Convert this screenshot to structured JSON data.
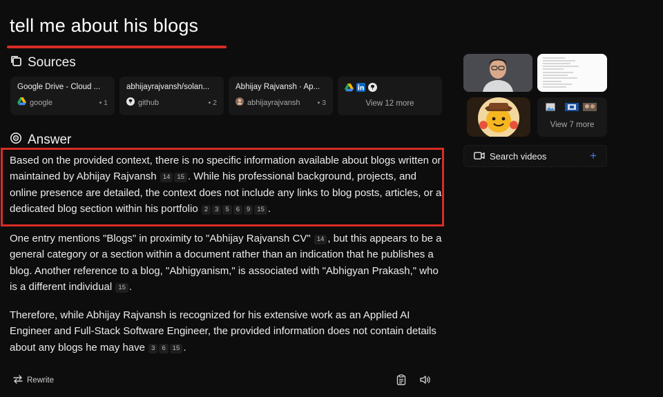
{
  "query": "tell me about his blogs",
  "sources": {
    "heading": "Sources",
    "cards": [
      {
        "title": "Google Drive - Cloud ...",
        "site": "google",
        "num": "1"
      },
      {
        "title": "abhijayrajvansh/solan...",
        "site": "github",
        "num": "2"
      },
      {
        "title": "Abhijay Rajvansh · Ap...",
        "site": "abhijayrajvansh",
        "num": "3"
      }
    ],
    "more_label": "View 12 more"
  },
  "answer": {
    "heading": "Answer",
    "p1": {
      "a": "Based on the provided context, there is no specific information available about blogs written or maintained by Abhijay Rajvansh",
      "c1": [
        "14",
        "15"
      ],
      "b": ". While his professional background, projects, and online presence are detailed, the context does not include any links to blog posts, articles, or a dedicated blog section within his portfolio",
      "c2": [
        "2",
        "3",
        "5",
        "6",
        "9",
        "15"
      ],
      "end": "."
    },
    "p2": {
      "a": "One entry mentions \"Blogs\" in proximity to \"Abhijay Rajvansh CV\"",
      "c1": [
        "14"
      ],
      "b": ", but this appears to be a general category or a section within a document rather than an indication that he publishes a blog. Another reference to a blog, \"Abhigyanism,\" is associated with \"Abhigyan Prakash,\" who is a different individual",
      "c2": [
        "15"
      ],
      "end": "."
    },
    "p3": {
      "a": "Therefore, while Abhijay Rajvansh is recognized for his extensive work as an Applied AI Engineer and Full-Stack Software Engineer, the provided information does not contain details about any blogs he may have",
      "c1": [
        "3",
        "6",
        "15"
      ],
      "end": "."
    }
  },
  "actions": {
    "rewrite": "Rewrite"
  },
  "media": {
    "view_more": "View 7 more",
    "search_videos": "Search videos"
  },
  "colors": {
    "accent_red": "#d82c25",
    "link_blue": "#3d82f3",
    "background": "#0d0d0d"
  }
}
